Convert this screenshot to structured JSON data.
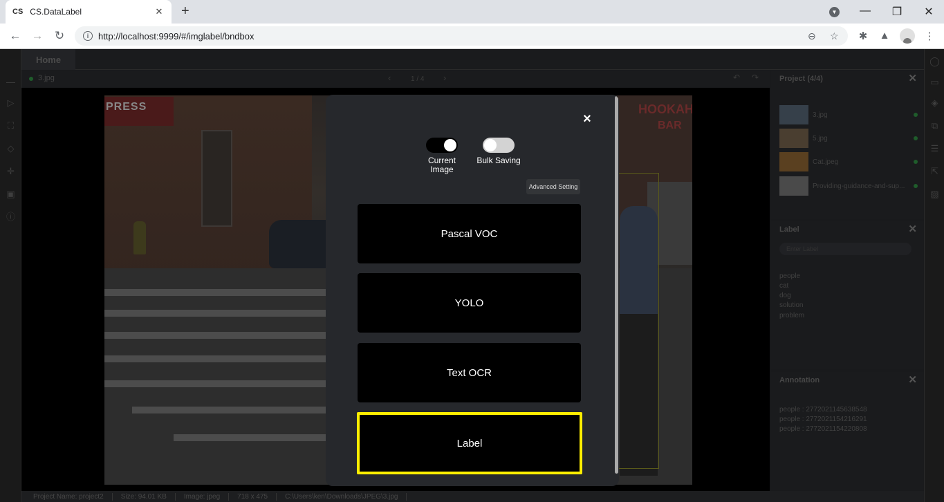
{
  "browser": {
    "tab_favicon": "CS",
    "tab_title": "CS.DataLabel",
    "tab_close": "✕",
    "new_tab": "+",
    "url": "http://localhost:9999/#/imglabel/bndbox"
  },
  "app": {
    "home_tab": "Home",
    "current_file": "3.jpg",
    "pager": "1 / 4"
  },
  "image": {
    "press_sign": "PRESS",
    "hookah_sign": "HOOKAH",
    "bar_sign": "BAR"
  },
  "status": {
    "project": "Project Name: project2",
    "size": "Size: 94.01 KB",
    "image_type": "Image: jpeg",
    "dimensions": "718 x 475",
    "path": "C:\\Users\\ken\\Downloads\\JPEG\\3.jpg"
  },
  "panels": {
    "project": {
      "title": "Project (4/4)",
      "files": [
        "3.jpg",
        "5.jpg",
        "Cat.jpeg",
        "Providing-guidance-and-sup..."
      ]
    },
    "label": {
      "title": "Label",
      "placeholder": "Enter Label",
      "items": [
        "people",
        "cat",
        "dog",
        "solution",
        "problem"
      ]
    },
    "annotation": {
      "title": "Annotation",
      "items": [
        "people : 2772021145638548",
        "people : 2772021154216291",
        "people : 2772021154220808"
      ]
    }
  },
  "modal": {
    "close": "×",
    "toggle_current": "Current Image",
    "toggle_bulk": "Bulk Saving",
    "current_on": true,
    "bulk_on": false,
    "advanced": "Advanced Setting",
    "formats": [
      "Pascal VOC",
      "YOLO",
      "Text OCR",
      "Label"
    ],
    "selected_format": "Label",
    "highlight_color": "#ffee00"
  }
}
